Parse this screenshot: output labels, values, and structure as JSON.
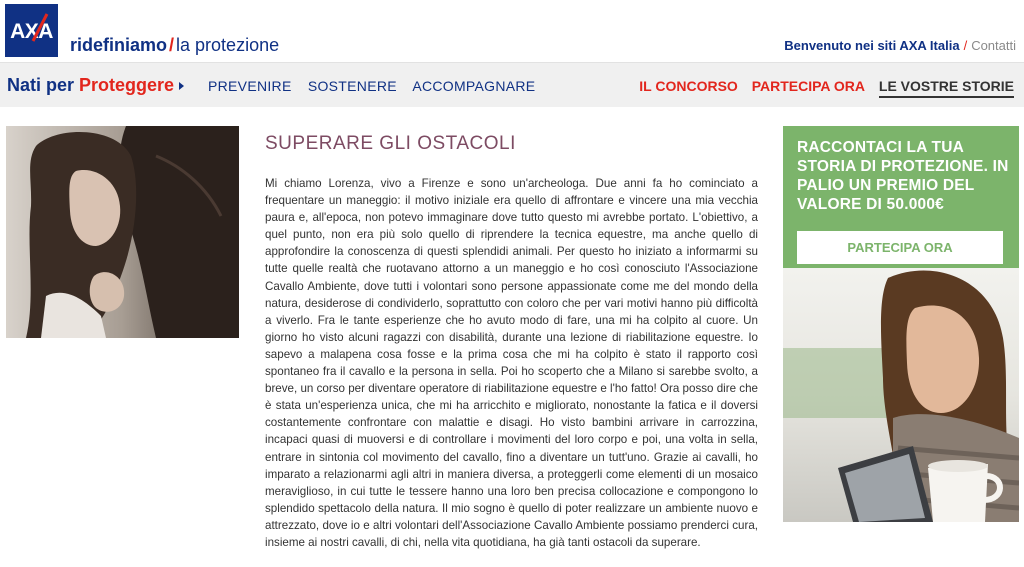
{
  "header": {
    "logo_text": "AXA",
    "tagline_bold": "ridefiniamo",
    "tagline_rest": "la protezione",
    "welcome": "Benvenuto nei siti AXA Italia",
    "contacts": "Contatti"
  },
  "nav": {
    "brand_part1": "Nati per ",
    "brand_part2": "Proteggere",
    "links": [
      "PREVENIRE",
      "SOSTENERE",
      "ACCOMPAGNARE"
    ],
    "right_links": [
      "IL CONCORSO",
      "PARTECIPA ORA",
      "LE VOSTRE STORIE"
    ]
  },
  "article": {
    "title": "SUPERARE GLI OSTACOLI",
    "body": "Mi chiamo Lorenza, vivo a Firenze e sono un'archeologa. Due anni fa ho cominciato a frequentare un maneggio: il motivo iniziale era quello di affrontare e vincere una mia vecchia paura e, all'epoca, non potevo immaginare dove tutto questo mi avrebbe portato. L'obiettivo, a quel punto, non era più solo quello di riprendere la tecnica equestre, ma anche quello di approfondire la conoscenza di questi splendidi animali. Per questo ho iniziato a informarmi su tutte quelle realtà che ruotavano attorno a un maneggio e ho così conosciuto l'Associazione Cavallo Ambiente, dove tutti i volontari sono persone appassionate come me del mondo della natura, desiderose di condividerlo, soprattutto con coloro che per vari motivi hanno più difficoltà a viverlo. Fra le tante esperienze che ho avuto modo di fare, una mi ha colpito al cuore. Un giorno ho visto alcuni ragazzi con disabilità, durante una lezione di riabilitazione equestre. Io sapevo a malapena cosa fosse e la prima cosa che mi ha colpito è stato il rapporto così spontaneo fra il cavallo e la persona in sella. Poi ho scoperto che a Milano si sarebbe svolto, a breve, un corso per diventare operatore di riabilitazione equestre e l'ho fatto! Ora posso dire che è stata un'esperienza unica, che mi ha arricchito e migliorato, nonostante la fatica e il doversi costantemente confrontare con malattie e disagi. Ho visto bambini arrivare in carrozzina, incapaci quasi di muoversi e di controllare i movimenti del loro corpo e poi, una volta in sella, entrare in sintonia col movimento del cavallo, fino a diventare un tutt'uno. Grazie ai cavalli, ho imparato a relazionarmi agli altri in maniera diversa, a proteggerli come elementi di un mosaico meraviglioso, in cui tutte le tessere hanno una loro ben precisa collocazione e compongono lo splendido spettacolo della natura. Il mio sogno è quello di poter realizzare un ambiente nuovo e attrezzato, dove io e altri volontari dell'Associazione Cavallo Ambiente possiamo prenderci cura, insieme ai nostri cavalli, di chi, nella vita quotidiana, ha già tanti ostacoli da superare."
  },
  "promo": {
    "title": "RACCONTACI LA TUA STORIA DI PROTEZIONE. IN PALIO UN PREMIO DEL VALORE DI 50.000€",
    "button": "PARTECIPA ORA"
  },
  "colors": {
    "brand_blue": "#103184",
    "brand_red": "#e2261d",
    "promo_green": "#7cb46b",
    "title_mauve": "#7d4b63"
  }
}
